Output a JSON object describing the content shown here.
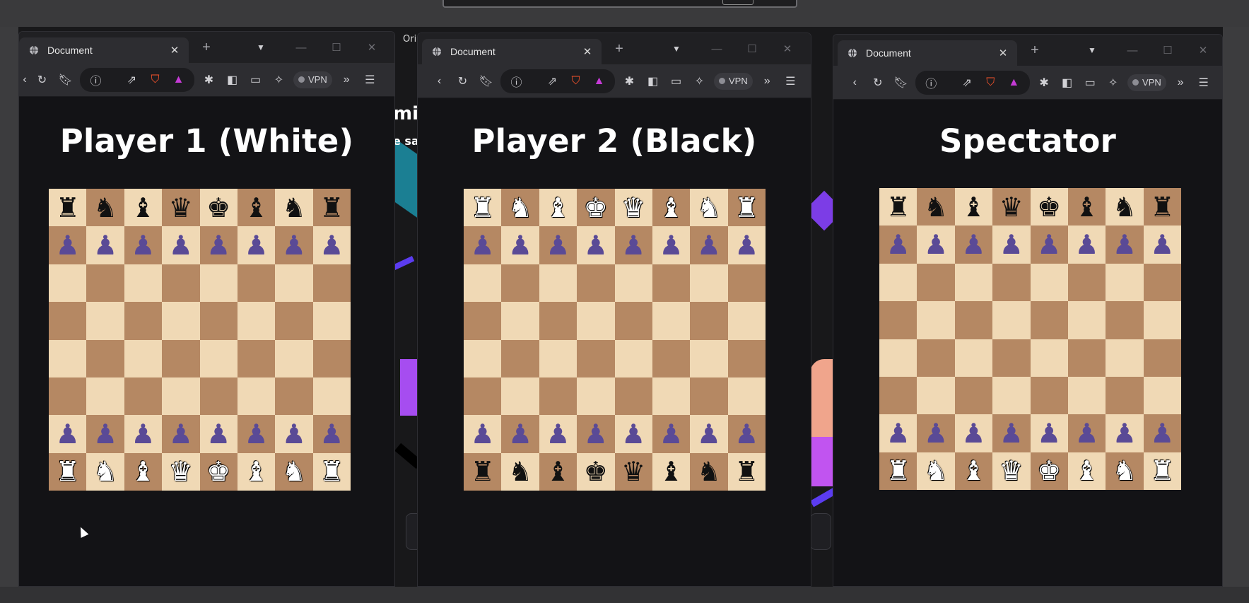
{
  "windows": [
    {
      "id": "player1",
      "tab_title": "Document",
      "heading": "Player 1 (White)",
      "board": [
        [
          "bR",
          "bN",
          "bB",
          "bQ",
          "bK",
          "bB",
          "bN",
          "bR"
        ],
        [
          "bP",
          "bP",
          "bP",
          "bP",
          "bP",
          "bP",
          "bP",
          "bP"
        ],
        [
          "",
          "",
          "",
          "",
          "",
          "",
          "",
          ""
        ],
        [
          "",
          "",
          "",
          "",
          "",
          "",
          "",
          ""
        ],
        [
          "",
          "",
          "",
          "",
          "",
          "",
          "",
          ""
        ],
        [
          "",
          "",
          "",
          "",
          "",
          "",
          "",
          ""
        ],
        [
          "wP",
          "wP",
          "wP",
          "wP",
          "wP",
          "wP",
          "wP",
          "wP"
        ],
        [
          "wR",
          "wN",
          "wB",
          "wQ",
          "wK",
          "wB",
          "wN",
          "wR"
        ]
      ]
    },
    {
      "id": "player2",
      "tab_title": "Document",
      "heading": "Player 2 (Black)",
      "board": [
        [
          "wR",
          "wN",
          "wB",
          "wK",
          "wQ",
          "wB",
          "wN",
          "wR"
        ],
        [
          "wP",
          "wP",
          "wP",
          "wP",
          "wP",
          "wP",
          "wP",
          "wP"
        ],
        [
          "",
          "",
          "",
          "",
          "",
          "",
          "",
          ""
        ],
        [
          "",
          "",
          "",
          "",
          "",
          "",
          "",
          ""
        ],
        [
          "",
          "",
          "",
          "",
          "",
          "",
          "",
          ""
        ],
        [
          "",
          "",
          "",
          "",
          "",
          "",
          "",
          ""
        ],
        [
          "bP",
          "bP",
          "bP",
          "bP",
          "bP",
          "bP",
          "bP",
          "bP"
        ],
        [
          "bR",
          "bN",
          "bB",
          "bK",
          "bQ",
          "bB",
          "bN",
          "bR"
        ]
      ]
    },
    {
      "id": "spectator",
      "tab_title": "Document",
      "heading": "Spectator",
      "board": [
        [
          "bR",
          "bN",
          "bB",
          "bQ",
          "bK",
          "bB",
          "bN",
          "bR"
        ],
        [
          "bP",
          "bP",
          "bP",
          "bP",
          "bP",
          "bP",
          "bP",
          "bP"
        ],
        [
          "",
          "",
          "",
          "",
          "",
          "",
          "",
          ""
        ],
        [
          "",
          "",
          "",
          "",
          "",
          "",
          "",
          ""
        ],
        [
          "",
          "",
          "",
          "",
          "",
          "",
          "",
          ""
        ],
        [
          "",
          "",
          "",
          "",
          "",
          "",
          "",
          ""
        ],
        [
          "wP",
          "wP",
          "wP",
          "wP",
          "wP",
          "wP",
          "wP",
          "wP"
        ],
        [
          "wR",
          "wN",
          "wB",
          "wQ",
          "wK",
          "wB",
          "wN",
          "wR"
        ]
      ]
    }
  ],
  "toolbar": {
    "vpn_label": "VPN"
  },
  "behind": {
    "text_fragments": [
      "Ori",
      "mir",
      "e sav"
    ]
  },
  "pieces": {
    "K": "♚",
    "Q": "♛",
    "R": "♜",
    "B": "♝",
    "N": "♞",
    "P": "♟"
  },
  "colors": {
    "board_light": "#f0d9b5",
    "board_dark": "#b58863",
    "pawn": "#5a4a96",
    "window_bg": "#131316",
    "toolbar_bg": "#2d2d31"
  }
}
